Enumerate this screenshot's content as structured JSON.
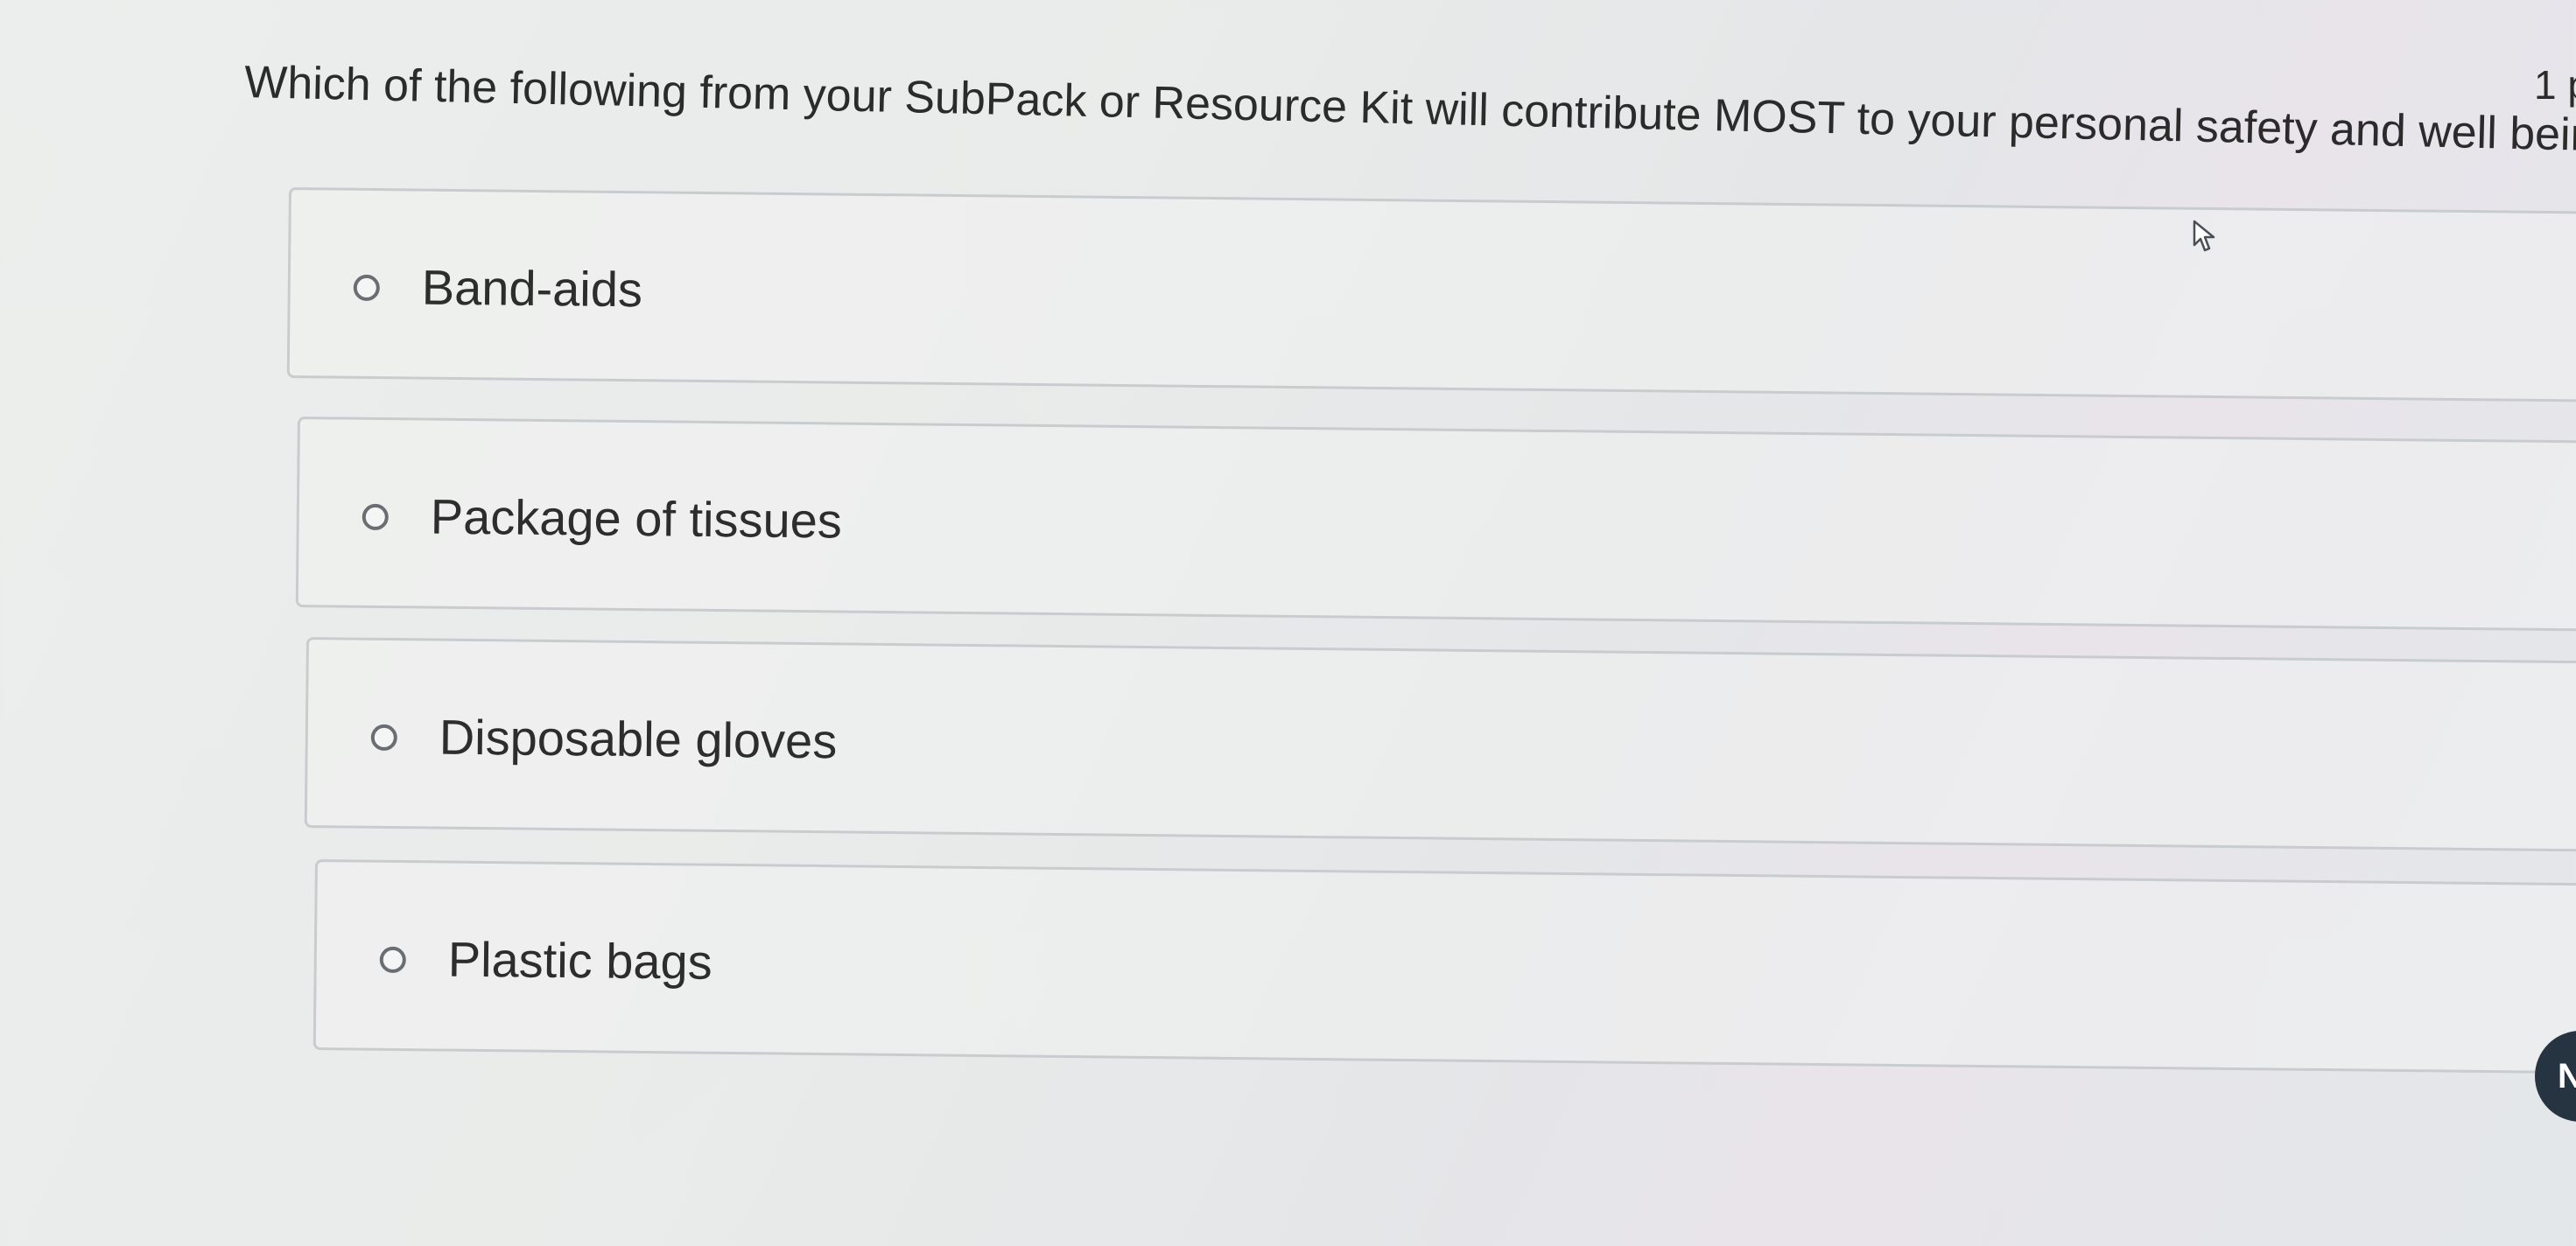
{
  "question": {
    "text": "Which of the following from your SubPack or Resource Kit will contribute MOST to your personal safety and well being?",
    "points": "1 p"
  },
  "options": [
    {
      "label": "Band-aids",
      "selected": false
    },
    {
      "label": "Package of tissues",
      "selected": false
    },
    {
      "label": "Disposable gloves",
      "selected": false
    },
    {
      "label": "Plastic bags",
      "selected": false
    }
  ],
  "next_button": {
    "label": "N"
  },
  "icons": {
    "cursor": "mouse-pointer-icon",
    "radio": "radio-unselected-icon"
  },
  "colors": {
    "text": "#2d2d2d",
    "border": "#c9cccf",
    "next_button_bg": "#263340"
  }
}
